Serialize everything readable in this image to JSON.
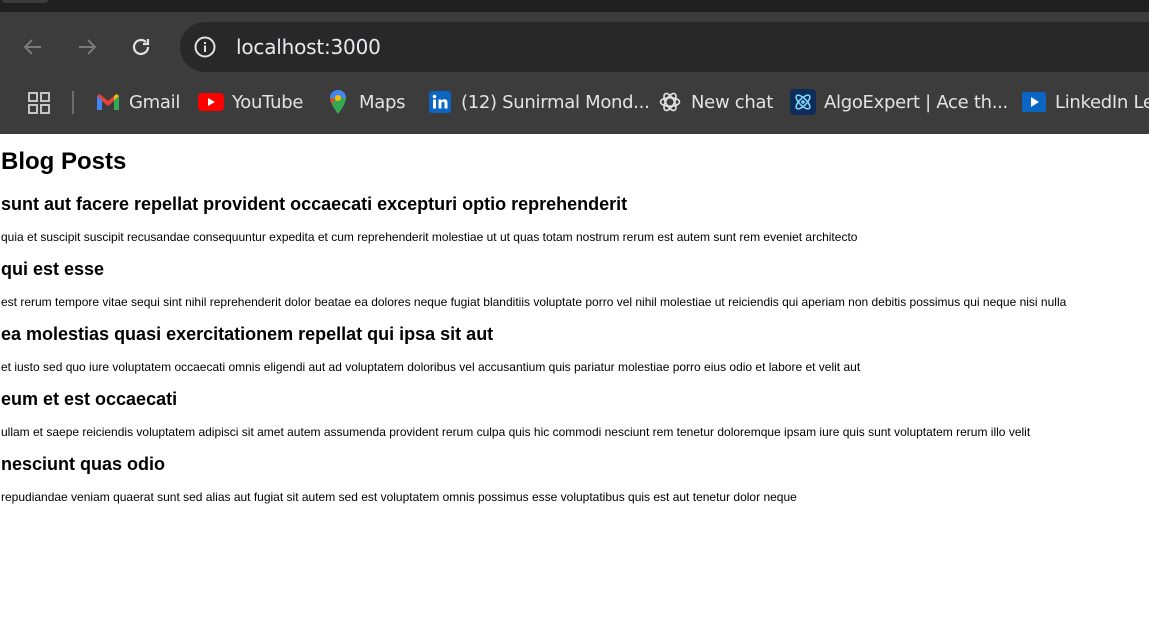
{
  "browser": {
    "address_bar": {
      "url": "localhost:3000"
    },
    "bookmarks": [
      {
        "label": "Gmail",
        "icon": "gmail-icon"
      },
      {
        "label": "YouTube",
        "icon": "youtube-icon"
      },
      {
        "label": "Maps",
        "icon": "maps-icon"
      },
      {
        "label": "(12) Sunirmal Mond...",
        "icon": "linkedin-icon"
      },
      {
        "label": "New chat",
        "icon": "chatgpt-icon"
      },
      {
        "label": "AlgoExpert | Ace th...",
        "icon": "algoexpert-icon"
      },
      {
        "label": "LinkedIn Lea",
        "icon": "linkedin-learning-icon"
      }
    ]
  },
  "page": {
    "heading": "Blog Posts",
    "posts": [
      {
        "title": "sunt aut facere repellat provident occaecati excepturi optio reprehenderit",
        "body": "quia et suscipit suscipit recusandae consequuntur expedita et cum reprehenderit molestiae ut ut quas totam nostrum rerum est autem sunt rem eveniet architecto"
      },
      {
        "title": "qui est esse",
        "body": "est rerum tempore vitae sequi sint nihil reprehenderit dolor beatae ea dolores neque fugiat blanditiis voluptate porro vel nihil molestiae ut reiciendis qui aperiam non debitis possimus qui neque nisi nulla"
      },
      {
        "title": "ea molestias quasi exercitationem repellat qui ipsa sit aut",
        "body": "et iusto sed quo iure voluptatem occaecati omnis eligendi aut ad voluptatem doloribus vel accusantium quis pariatur molestiae porro eius odio et labore et velit aut"
      },
      {
        "title": "eum et est occaecati",
        "body": "ullam et saepe reiciendis voluptatem adipisci sit amet autem assumenda provident rerum culpa quis hic commodi nesciunt rem tenetur doloremque ipsam iure quis sunt voluptatem rerum illo velit"
      },
      {
        "title": "nesciunt quas odio",
        "body": "repudiandae veniam quaerat sunt sed alias aut fugiat sit autem sed est voluptatem omnis possimus esse voluptatibus quis est aut tenetur dolor neque"
      }
    ]
  },
  "colors": {
    "toolbar_bg": "#3c3c3c",
    "omnibox_bg": "#282828",
    "page_bg": "#ffffff",
    "text": "#000000"
  }
}
